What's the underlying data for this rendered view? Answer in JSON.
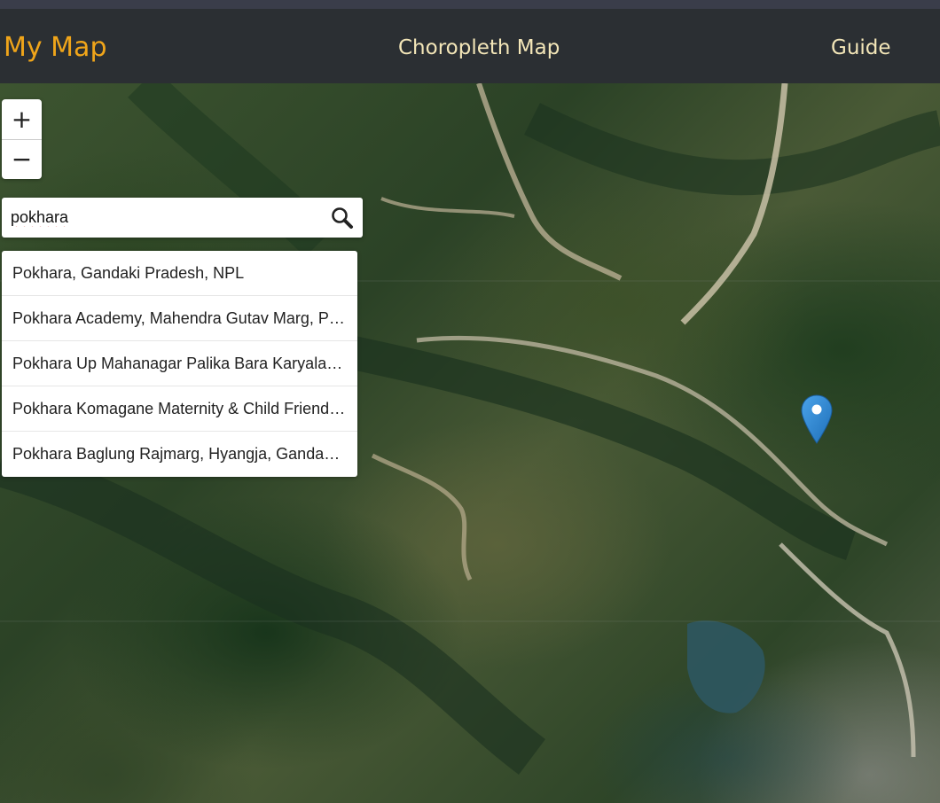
{
  "navbar": {
    "brand": "My Map",
    "links": [
      "Choropleth Map",
      "Guide"
    ]
  },
  "map": {
    "zoom_in_label": "+",
    "zoom_out_label": "−",
    "search": {
      "value": "pokhara",
      "icon": "search-icon"
    },
    "results": [
      "Pokhara, Gandaki Pradesh, NPL",
      "Pokhara Academy, Mahendra Gutav Marg, Pokhara, Gandaki Pradesh, NPL",
      "Pokhara Up Mahanagar Palika Bara Karyalaya, Pokhara, Gandaki Pradesh, NPL",
      "Pokhara Komagane Maternity & Child Friendly Hospital, Pokhara, Gandaki Pradesh, NPL",
      "Pokhara Baglung Rajmarg, Hyangja, Gandaki Pradesh, NPL"
    ],
    "marker_icon": "map-pin-icon"
  },
  "colors": {
    "brand": "#f0a51a",
    "nav_text": "#f3e6b8",
    "navbar_bg": "#2b2f33",
    "marker": "#2f8ad8"
  }
}
